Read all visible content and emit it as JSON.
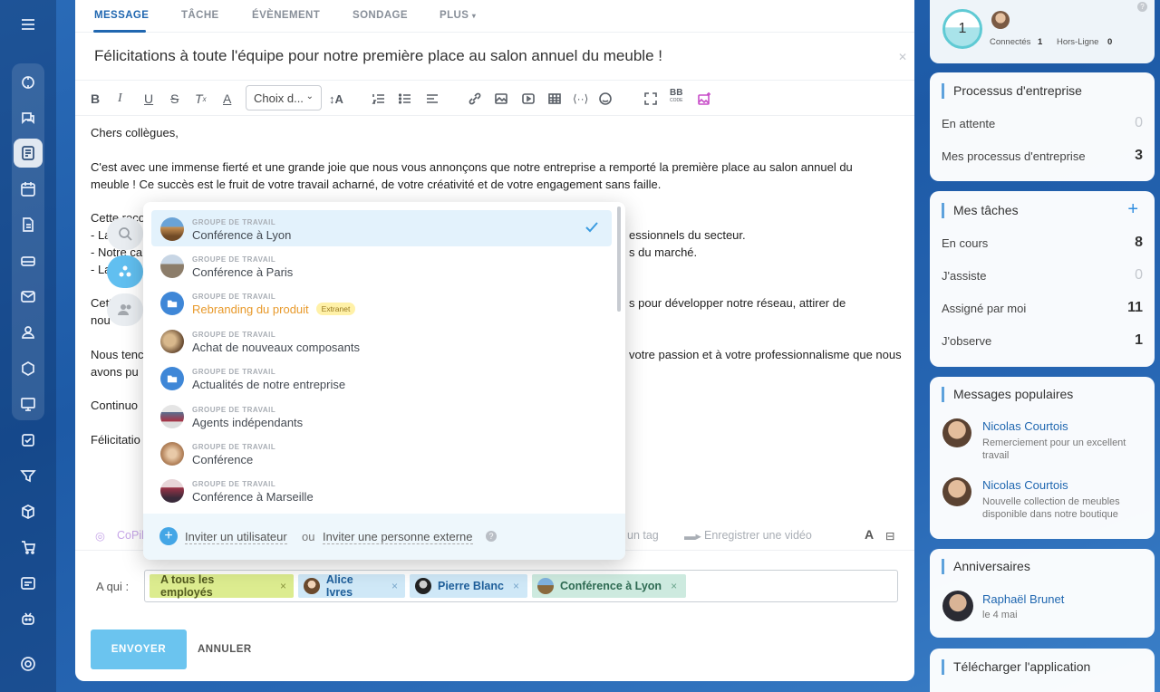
{
  "tabs": [
    {
      "label": "MESSAGE"
    },
    {
      "label": "TÂCHE"
    },
    {
      "label": "ÉVÈNEMENT"
    },
    {
      "label": "SONDAGE"
    },
    {
      "label": "PLUS"
    }
  ],
  "subject": "Félicitations à toute l'équipe pour notre première place au salon annuel du meuble !",
  "toolbar": {
    "font_select": "Choix d...",
    "bbcode_top": "BB",
    "bbcode_bottom": "CODE"
  },
  "editor": {
    "lines": [
      "Chers collègues,",
      "C'est avec une immense fierté et une grande joie que nous vous annonçons que notre entreprise a remporté la première place au salon annuel du",
      "meuble ! Ce succès est le fruit de votre travail acharné, de votre créativité et de votre engagement sans faille.",
      "Cette reco",
      "- La",
      "- Notre ca",
      "- La",
      "Cett",
      "nou",
      "Nous tenc",
      "avons pu",
      "Continuo",
      "Félicitatio"
    ],
    "right_fragments": [
      "essionnels du secteur.",
      "s du marché.",
      "s pour développer notre réseau, attirer de",
      "votre passion et à votre professionnalisme que nous"
    ]
  },
  "bottom_bar": {
    "copilot": "CoPil",
    "tag": "un tag",
    "record": "Enregistrer une vidéo",
    "font": "A"
  },
  "popup": {
    "items": [
      {
        "kicker": "GROUPE DE TRAVAIL",
        "name": "Conférence à Lyon",
        "selected": true
      },
      {
        "kicker": "GROUPE DE TRAVAIL",
        "name": "Conférence à Paris"
      },
      {
        "kicker": "GROUPE DE TRAVAIL",
        "name": "Rebranding du produit",
        "badge": "Extranet"
      },
      {
        "kicker": "GROUPE DE TRAVAIL",
        "name": "Achat de nouveaux composants"
      },
      {
        "kicker": "GROUPE DE TRAVAIL",
        "name": "Actualités de notre entreprise"
      },
      {
        "kicker": "GROUPE DE TRAVAIL",
        "name": "Agents indépendants"
      },
      {
        "kicker": "GROUPE DE TRAVAIL",
        "name": "Conférence"
      },
      {
        "kicker": "GROUPE DE TRAVAIL",
        "name": "Conférence à Marseille"
      }
    ],
    "footer": {
      "invite_user": "Inviter un utilisateur",
      "or": "ou",
      "invite_external": "Inviter une personne externe",
      "help": "?"
    }
  },
  "recipients": {
    "label": "A qui :",
    "chips": [
      {
        "label": "A tous les employés"
      },
      {
        "label": "Alice Ivres"
      },
      {
        "label": "Pierre Blanc"
      },
      {
        "label": "Conférence à Lyon"
      }
    ],
    "remove": "×"
  },
  "actions": {
    "send": "ENVOYER",
    "cancel": "ANNULER"
  },
  "presence": {
    "count": "1",
    "connected_label": "Connectés",
    "connected_value": "1",
    "offline_label": "Hors-Ligne",
    "offline_value": "0",
    "help": "?"
  },
  "business_processes": {
    "title": "Processus d'entreprise",
    "rows": [
      {
        "label": "En attente",
        "value": "0"
      },
      {
        "label": "Mes processus d'entreprise",
        "value": "3"
      }
    ]
  },
  "my_tasks": {
    "title": "Mes tâches",
    "add": "+",
    "rows": [
      {
        "label": "En cours",
        "value": "8"
      },
      {
        "label": "J'assiste",
        "value": "0"
      },
      {
        "label": "Assigné par moi",
        "value": "11"
      },
      {
        "label": "J'observe",
        "value": "1"
      }
    ]
  },
  "popular": {
    "title": "Messages populaires",
    "items": [
      {
        "author": "Nicolas Courtois",
        "text": "Remerciement pour un excellent travail"
      },
      {
        "author": "Nicolas Courtois",
        "text": "Nouvelle collection de meubles disponible dans notre boutique"
      }
    ]
  },
  "birthdays": {
    "title": "Anniversaires",
    "name": "Raphaël Brunet",
    "date": "le 4 mai"
  },
  "download": {
    "title": "Télécharger l'application"
  },
  "colors": {
    "accent": "#2067b0",
    "send_button": "#6bc4ef",
    "chip_all": "#dcec8f",
    "chip_user": "#cfe8f7",
    "chip_group": "#cdeadf"
  }
}
